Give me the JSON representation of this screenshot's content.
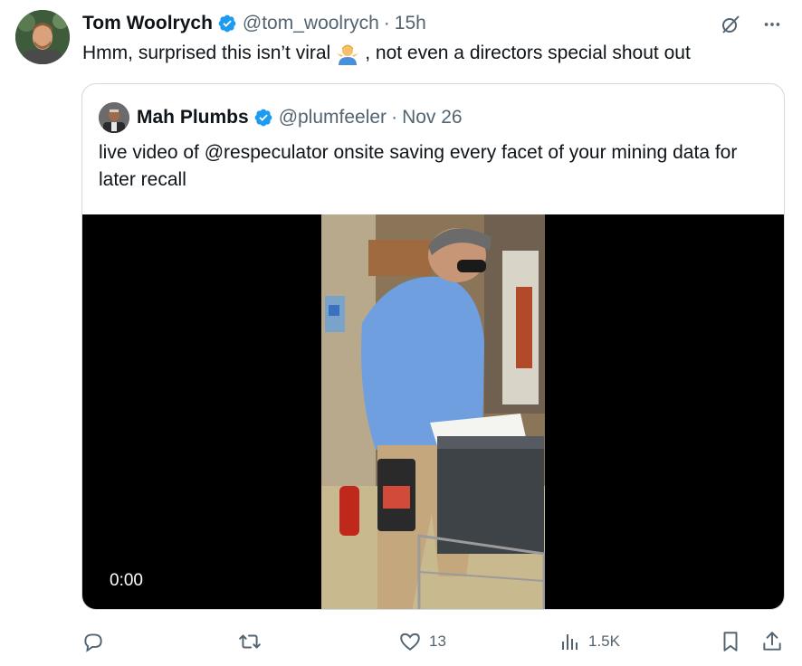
{
  "tweet": {
    "author_name": "Tom Woolrych",
    "handle": "@tom_woolrych",
    "separator": "·",
    "time": "15h",
    "text_before": "Hmm, surprised this isn’t viral",
    "emoji": "man-shrugging-emoji",
    "text_after": ", not even a directors special shout out"
  },
  "quote": {
    "author_name": "Mah Plumbs",
    "handle": "@plumfeeler",
    "separator": "·",
    "time": "Nov 26",
    "text": "live video of @respeculator onsite saving every facet of your mining data for later recall",
    "video_time": "0:00"
  },
  "actions": {
    "reply_count": "",
    "retweet_count": "",
    "like_count": "13",
    "views_count": "1.5K"
  },
  "colors": {
    "text": "#0f1419",
    "secondary": "#536471",
    "verified": "#1d9bf0",
    "border": "#cfd9de"
  }
}
